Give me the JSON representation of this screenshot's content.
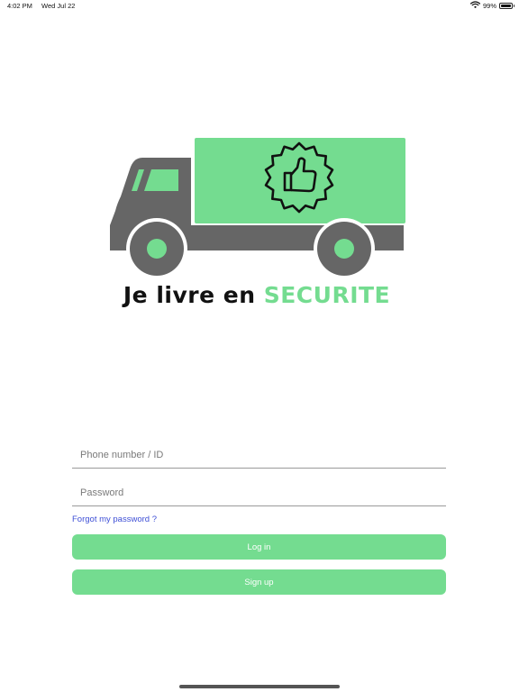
{
  "status_bar": {
    "time": "4:02 PM",
    "date": "Wed Jul 22",
    "battery_text": "99%",
    "battery_level": 0.99
  },
  "logo": {
    "text_dark": "Je livre en",
    "text_green": "SECURITE"
  },
  "form": {
    "phone_placeholder": "Phone number / ID",
    "phone_value": "",
    "password_placeholder": "Password",
    "password_value": "",
    "forgot_label": "Forgot my password ?"
  },
  "buttons": {
    "login_label": "Log in",
    "signup_label": "Sign up"
  },
  "colors": {
    "accent_green": "#74dc90",
    "truck_gray": "#666666",
    "link_blue": "#3e4fd6"
  },
  "icons": {
    "wifi": "wifi-icon",
    "battery": "battery-icon",
    "badge": "thumbs-up-badge-icon",
    "truck": "truck-icon"
  }
}
